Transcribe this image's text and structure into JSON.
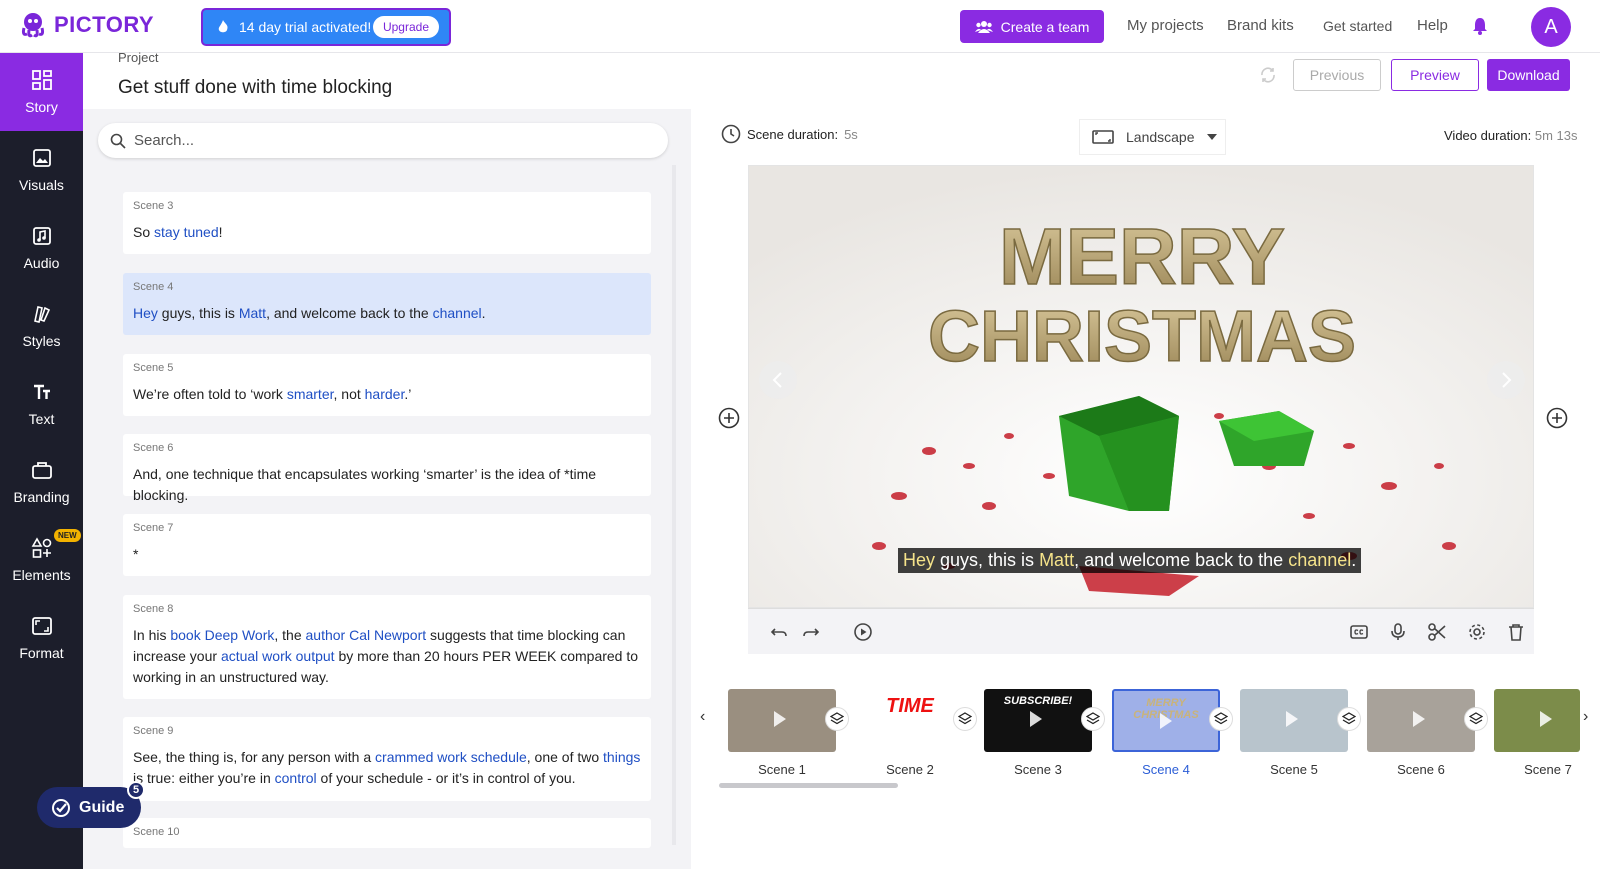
{
  "app": {
    "name": "PICTORY"
  },
  "colors": {
    "brand": "#8a2be2",
    "sidebar_bg": "#1c1e2b",
    "trial_bg": "#2f86f6",
    "keyword": "#1f4fc4"
  },
  "header": {
    "trial_text": "14 day trial activated!",
    "upgrade_label": "Upgrade",
    "create_team_label": "Create a team",
    "nav": [
      "My projects",
      "Brand kits",
      "Get started",
      "Help"
    ],
    "avatar_letter": "A"
  },
  "sidebar": {
    "items": [
      {
        "label": "Story",
        "icon": "grid-icon",
        "active": true
      },
      {
        "label": "Visuals",
        "icon": "image-icon"
      },
      {
        "label": "Audio",
        "icon": "music-icon"
      },
      {
        "label": "Styles",
        "icon": "styles-icon"
      },
      {
        "label": "Text",
        "icon": "text-icon"
      },
      {
        "label": "Branding",
        "icon": "briefcase-icon"
      },
      {
        "label": "Elements",
        "icon": "shapes-icon",
        "badge": "NEW"
      },
      {
        "label": "Format",
        "icon": "format-icon"
      }
    ]
  },
  "project": {
    "label": "Project",
    "title": "Get stuff done with time blocking",
    "previous_label": "Previous",
    "preview_label": "Preview",
    "download_label": "Download"
  },
  "search": {
    "placeholder": "Search..."
  },
  "scenes": [
    {
      "num": "Scene 3",
      "html": "So <span class='kw'>stay tuned</span>!"
    },
    {
      "num": "Scene 4",
      "html": "<span class='kw'>Hey</span> guys, this is <span class='kw'>Matt</span>, and welcome back to the <span class='kw'>channel</span>.",
      "selected": true
    },
    {
      "num": "Scene 5",
      "html": "We’re often told to ‘work <span class='kw'>smarter</span>, not <span class='kw'>harder</span>.’"
    },
    {
      "num": "Scene 6",
      "html": "And, one technique that encapsulates working ‘smarter’ is the idea of *time blocking."
    },
    {
      "num": "Scene 7",
      "html": "*"
    },
    {
      "num": "Scene 8",
      "html": "In his <span class='kw'>book Deep Work</span>, the <span class='kw'>author Cal Newport</span> suggests that time blocking can increase your <span class='kw'>actual work output</span> by more than 20 hours PER WEEK compared to working in an unstructured way."
    },
    {
      "num": "Scene 9",
      "html": "See, the thing is, for any person with a <span class='kw'>crammed work schedule</span>, one of two <span class='kw'>things</span> is true: either you’re in <span class='kw'>control</span> of your schedule - or it’s in control of you."
    },
    {
      "num": "Scene 10",
      "html": ""
    }
  ],
  "guide": {
    "label": "Guide",
    "count": "5"
  },
  "editor": {
    "scene_duration_label": "Scene duration:",
    "scene_duration_value": "5s",
    "orientation": "Landscape",
    "video_duration_label": "Video duration:",
    "video_duration_value": "5m 13s",
    "preview_art_text": [
      "MERRY",
      "CHRISTMAS"
    ],
    "caption_parts": [
      {
        "t": "Hey",
        "hl": true
      },
      {
        "t": " guys, this is ",
        "hl": false
      },
      {
        "t": "Matt",
        "hl": true
      },
      {
        "t": ", and welcome back to the ",
        "hl": false
      },
      {
        "t": "channel",
        "hl": true
      },
      {
        "t": ".",
        "hl": false
      }
    ]
  },
  "timeline": {
    "thumbs": [
      {
        "label": "Scene 1",
        "bg": "#9a8f80"
      },
      {
        "label": "Scene 2",
        "bg": "#ffffff",
        "art": "TIME"
      },
      {
        "label": "Scene 3",
        "bg": "#111111",
        "art": "SUBSCRIBE!"
      },
      {
        "label": "Scene 4",
        "bg": "#9fb0e8",
        "art": "MERRY CHRISTMAS",
        "selected": true
      },
      {
        "label": "Scene 5",
        "bg": "#b8c4cc"
      },
      {
        "label": "Scene 6",
        "bg": "#a8a29a"
      },
      {
        "label": "Scene 7",
        "bg": "#7c8c4a"
      }
    ]
  }
}
